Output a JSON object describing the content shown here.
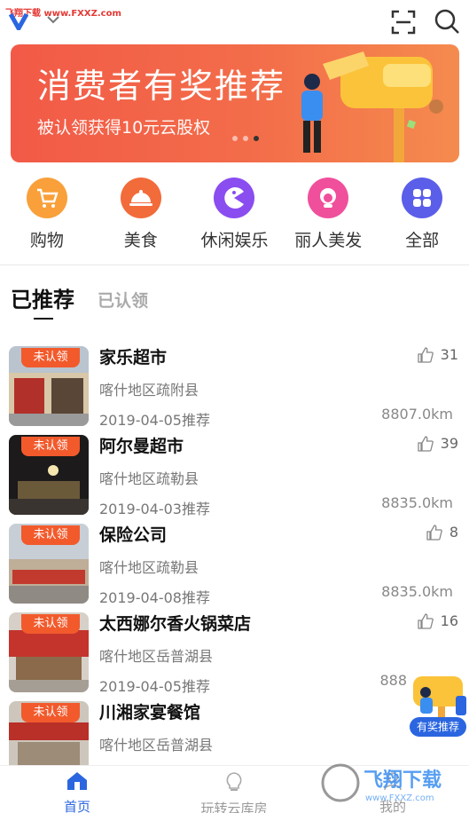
{
  "watermark_top": "飞翔下载 www.FXXZ.com",
  "header": {
    "logo_icon": "v-logo-icon",
    "dropdown_icon": "chevron-down-icon",
    "scan_icon": "scan-icon",
    "search_icon": "search-icon"
  },
  "banner": {
    "title": "消费者有奖推荐",
    "subtitle": "被认领获得10元云股权",
    "page_count": 3,
    "active_page": 3
  },
  "categories": [
    {
      "label": "购物",
      "icon": "cart-icon",
      "color": "#f9a03a"
    },
    {
      "label": "美食",
      "icon": "dish-icon",
      "color": "#f26b3a"
    },
    {
      "label": "休闲娱乐",
      "icon": "pacman-icon",
      "color": "#8a4df0"
    },
    {
      "label": "丽人美发",
      "icon": "beauty-icon",
      "color": "#f04f9c"
    },
    {
      "label": "全部",
      "icon": "grid-icon",
      "color": "#5b5ee8"
    }
  ],
  "tabs": {
    "active": "已推荐",
    "inactive": "已认领"
  },
  "badge_label": "未认领",
  "items": [
    {
      "name": "家乐超市",
      "address": "喀什地区疏附县",
      "date": "2019-04-05推荐",
      "likes": "31",
      "distance": "8807.0km"
    },
    {
      "name": "阿尔曼超市",
      "address": "喀什地区疏勒县",
      "date": "2019-04-03推荐",
      "likes": "39",
      "distance": "8835.0km"
    },
    {
      "name": "保险公司",
      "address": "喀什地区疏勒县",
      "date": "2019-04-08推荐",
      "likes": "8",
      "distance": "8835.0km"
    },
    {
      "name": "太西娜尔香火锅菜店",
      "address": "喀什地区岳普湖县",
      "date": "2019-04-05推荐",
      "likes": "16",
      "distance": "888"
    },
    {
      "name": "川湘家宴餐馆",
      "address": "喀什地区岳普湖县",
      "date": "",
      "likes": "",
      "distance": ""
    }
  ],
  "floating_promo": {
    "label": "有奖推荐"
  },
  "bottom_nav": [
    {
      "label": "首页",
      "icon": "home-icon",
      "active": true
    },
    {
      "label": "玩转云库房",
      "icon": "bulb-icon",
      "active": false
    },
    {
      "label": "我的",
      "icon": "user-icon",
      "active": false
    }
  ],
  "watermark_bottom": "飞翔下载 www.FXXZ.com",
  "colors": {
    "accent": "#2b66e0",
    "banner": "#f25a47",
    "badge": "#f25a2c"
  }
}
